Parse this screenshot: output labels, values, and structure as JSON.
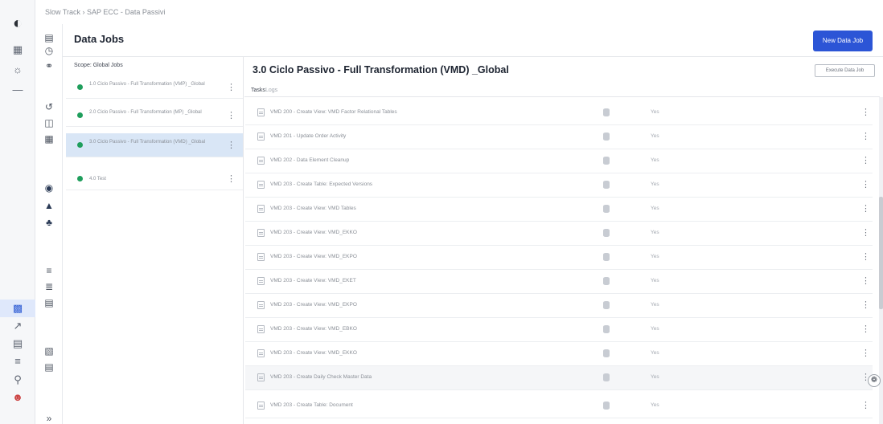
{
  "breadcrumb": "Slow Track  ›  SAP ECC - Data Passivi",
  "page": {
    "title": "Data Jobs",
    "new_button": "New Data Job"
  },
  "jobs_panel": {
    "scope_label": "Scope: Global Jobs",
    "jobs": [
      {
        "name": "1.0 Ciclo Passivo - Full Transformation (VMP) _Global",
        "selected": false
      },
      {
        "name": "2.0 Ciclo Passivo - Full Transformation (MP) _Global",
        "selected": false
      },
      {
        "name": "3.0 Ciclo Passivo - Full Transformation (VMD) _Global",
        "selected": true
      },
      {
        "name": "4.0 Test",
        "selected": false
      }
    ]
  },
  "job_detail": {
    "title": "3.0 Ciclo Passivo - Full Transformation (VMD) _Global",
    "execute_button": "Execute Data Job",
    "tabs": [
      "Tasks",
      "Logs"
    ],
    "tasks": [
      {
        "name": "VMD 200 - Create View: VMD Factor Relational Tables",
        "status": "Yes"
      },
      {
        "name": "VMD 201 - Update Order Activity",
        "status": "Yes"
      },
      {
        "name": "VMD 202 - Data Element Cleanup",
        "status": "Yes"
      },
      {
        "name": "VMD 203 - Create Table: Expected Versions",
        "status": "Yes"
      },
      {
        "name": "VMD 203 - Create View: VMD Tables",
        "status": "Yes"
      },
      {
        "name": "VMD 203 - Create View: VMD_EKKO",
        "status": "Yes"
      },
      {
        "name": "VMD 203 - Create View: VMD_EKPO",
        "status": "Yes"
      },
      {
        "name": "VMD 203 - Create View: VMD_EKET",
        "status": "Yes"
      },
      {
        "name": "VMD 203 - Create View: VMD_EKPO",
        "status": "Yes"
      },
      {
        "name": "VMD 203 - Create View: VMD_EBKO",
        "status": "Yes"
      },
      {
        "name": "VMD 203 - Create View: VMD_EKKO",
        "status": "Yes"
      },
      {
        "name": "VMD 203 - Create Daily Check Master Data",
        "status": "Yes"
      },
      {
        "name": "VMD 203 - Create Table: Document",
        "status": "Yes"
      }
    ]
  },
  "icons": {
    "rail": [
      "logo-icon",
      "grid-icon",
      "share-icon",
      "minus-icon",
      "tag-icon",
      "search-icon",
      "list-icon",
      "apps-icon",
      "data-icon",
      "filter-icon",
      "find-icon",
      "profile-icon"
    ],
    "rail2": [
      "doc-icon",
      "clock-icon",
      "node-icon",
      "flow-icon",
      "book-icon",
      "grid-small-icon",
      "database-icon",
      "person-icon",
      "tree-icon",
      "table-icon",
      "sort-icon",
      "layers-icon",
      "calendar-icon",
      "chart-icon",
      "double-chevron-icon"
    ]
  },
  "colors": {
    "primary": "#2c55d6",
    "selected_row": "#d9e6f6",
    "status_dot": "#1f9e5c"
  }
}
